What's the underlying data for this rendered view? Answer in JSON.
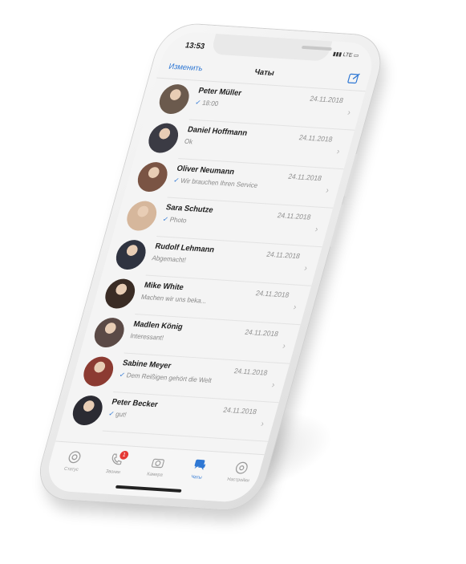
{
  "status_bar": {
    "time": "13:53",
    "network": "LTE"
  },
  "nav": {
    "edit_label": "Изменить",
    "title": "Чаты",
    "compose_icon": "compose-icon"
  },
  "chats": [
    {
      "name": "Peter Müller",
      "date": "24.11.2018",
      "preview": "18:00",
      "ticked": true,
      "avatar_color": "#6b5a4d"
    },
    {
      "name": "Daniel Hoffmann",
      "date": "24.11.2018",
      "preview": "Ok",
      "ticked": false,
      "avatar_color": "#3b3b44"
    },
    {
      "name": "Oliver Neumann",
      "date": "24.11.2018",
      "preview": "Wir brauchen Ihren Service",
      "ticked": true,
      "avatar_color": "#7a5444"
    },
    {
      "name": "Sara Schutze",
      "date": "24.11.2018",
      "preview": "Photo",
      "ticked": true,
      "avatar_color": "#d6b79c"
    },
    {
      "name": "Rudolf Lehmann",
      "date": "24.11.2018",
      "preview": "Abgemacht!",
      "ticked": false,
      "avatar_color": "#2f3340"
    },
    {
      "name": "Mike White",
      "date": "24.11.2018",
      "preview": "Machen wir uns beka...",
      "ticked": false,
      "avatar_color": "#3a2c25"
    },
    {
      "name": "Madlen König",
      "date": "24.11.2018",
      "preview": "Interessant!",
      "ticked": false,
      "avatar_color": "#5b4a46"
    },
    {
      "name": "Sabine Meyer",
      "date": "24.11.2018",
      "preview": "Dem Reißigen gehört die Welt",
      "ticked": true,
      "avatar_color": "#8c3b32"
    },
    {
      "name": "Peter Becker",
      "date": "24.11.2018",
      "preview": "gut!",
      "ticked": true,
      "avatar_color": "#2b2b33"
    }
  ],
  "tabs": [
    {
      "label": "Статус",
      "icon": "status-icon",
      "active": false
    },
    {
      "label": "Звонки",
      "icon": "phone-icon",
      "active": false,
      "badge": "1"
    },
    {
      "label": "Камера",
      "icon": "camera-icon",
      "active": false
    },
    {
      "label": "Чаты",
      "icon": "chats-icon",
      "active": true
    },
    {
      "label": "Настройки",
      "icon": "settings-icon",
      "active": false
    }
  ],
  "colors": {
    "accent": "#2f78d4",
    "badge": "#e53935"
  }
}
